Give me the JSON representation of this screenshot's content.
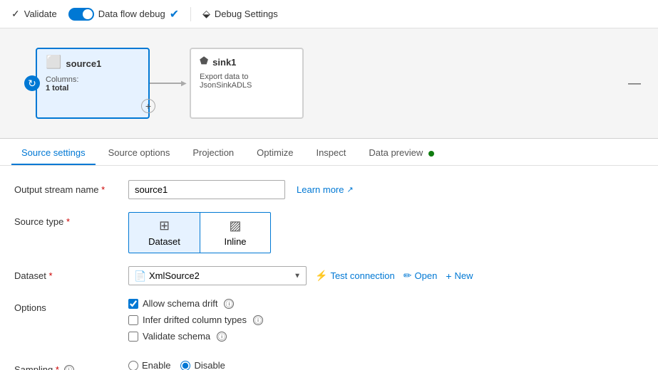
{
  "toolbar": {
    "validate_label": "Validate",
    "debug_label": "Data flow debug",
    "debug_settings_label": "Debug Settings"
  },
  "canvas": {
    "source_node": {
      "title": "source1",
      "sub_columns": "Columns:",
      "sub_count": "1 total"
    },
    "sink_node": {
      "title": "sink1",
      "sub": "Export data to JsonSinkADLS"
    }
  },
  "tabs": [
    {
      "id": "source-settings",
      "label": "Source settings",
      "active": true
    },
    {
      "id": "source-options",
      "label": "Source options",
      "active": false
    },
    {
      "id": "projection",
      "label": "Projection",
      "active": false
    },
    {
      "id": "optimize",
      "label": "Optimize",
      "active": false
    },
    {
      "id": "inspect",
      "label": "Inspect",
      "active": false
    },
    {
      "id": "data-preview",
      "label": "Data preview",
      "active": false,
      "dot": true
    }
  ],
  "form": {
    "output_stream_label": "Output stream name",
    "output_stream_required": "*",
    "output_stream_value": "source1",
    "learn_more_label": "Learn more",
    "source_type_label": "Source type",
    "source_type_required": "*",
    "source_type_dataset": "Dataset",
    "source_type_inline": "Inline",
    "dataset_label": "Dataset",
    "dataset_required": "*",
    "dataset_value": "XmlSource2",
    "test_connection_label": "Test connection",
    "open_label": "Open",
    "new_label": "New",
    "options_label": "Options",
    "allow_schema_drift": "Allow schema drift",
    "infer_drifted": "Infer drifted column types",
    "validate_schema": "Validate schema",
    "sampling_label": "Sampling",
    "sampling_required": "*",
    "sampling_enable": "Enable",
    "sampling_disable": "Disable"
  }
}
